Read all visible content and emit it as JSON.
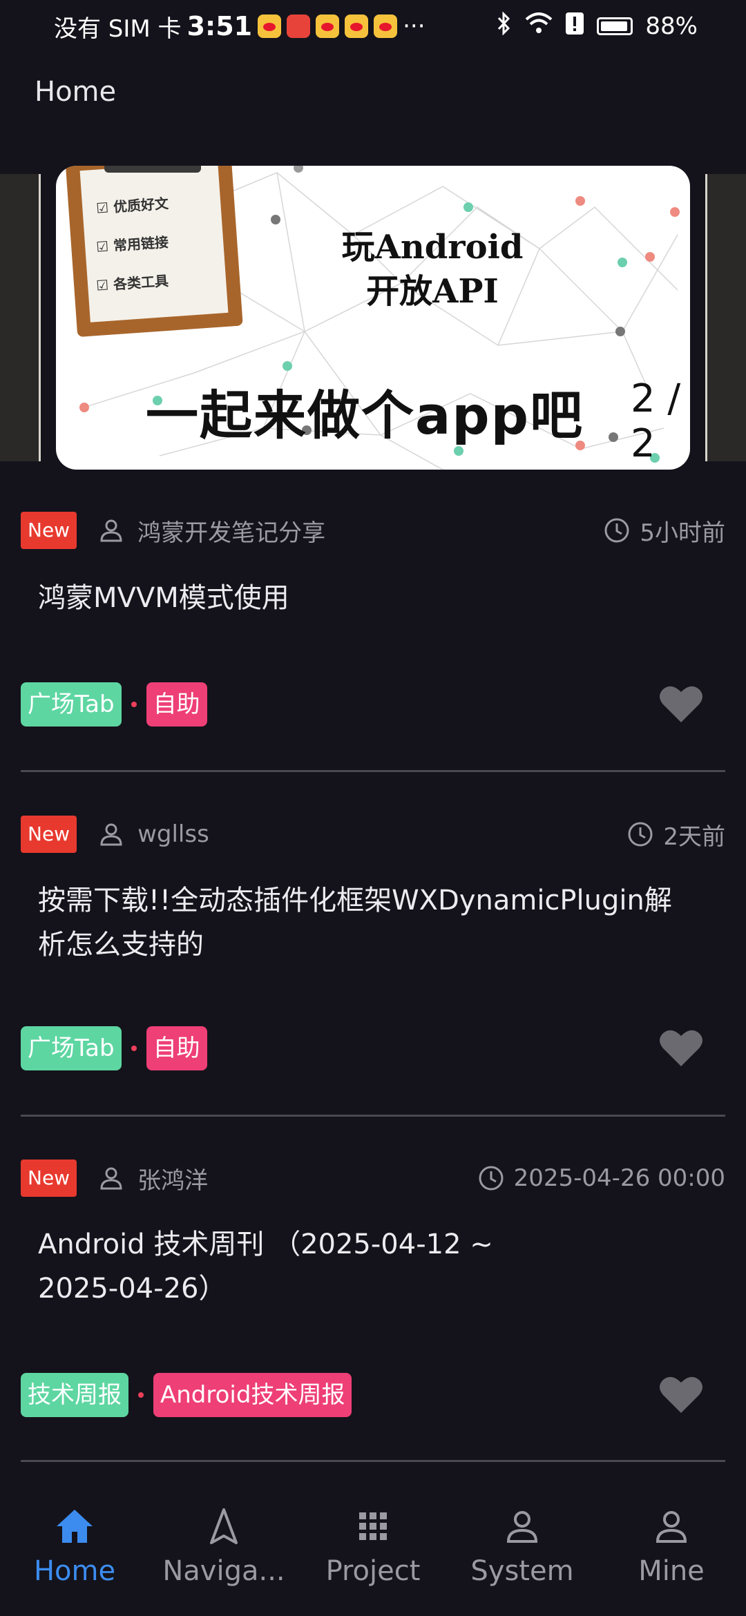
{
  "status_bar": {
    "carrier": "没有 SIM 卡",
    "time": "3:51",
    "more": "···",
    "battery": "88%"
  },
  "app_bar": {
    "title": "Home"
  },
  "banner": {
    "checklist": [
      "优质好文",
      "常用链接",
      "各类工具"
    ],
    "title_line1": "玩Android",
    "title_line2": "开放API",
    "slogan": "一起来做个app吧",
    "indicator": "2 / 2"
  },
  "articles": [
    {
      "badge": "New",
      "author": "鸿蒙开发笔记分享",
      "time": "5小时前",
      "title": "鸿蒙MVVM模式使用",
      "tags": [
        "广场Tab",
        "自助"
      ]
    },
    {
      "badge": "New",
      "author": "wgllss",
      "time": "2天前",
      "title": "按需下载!!全动态插件化框架WXDynamicPlugin解析怎么支持的",
      "tags": [
        "广场Tab",
        "自助"
      ]
    },
    {
      "badge": "New",
      "author": "张鸿洋",
      "time": "2025-04-26 00:00",
      "title": "Android 技术周刊 （2025-04-12 ~ 2025-04-26）",
      "tags": [
        "技术周报",
        "Android技术周报"
      ]
    }
  ],
  "bottom_nav": [
    {
      "label": "Home",
      "icon": "home-icon",
      "active": true
    },
    {
      "label": "Naviga...",
      "icon": "navigation-icon",
      "active": false
    },
    {
      "label": "Project",
      "icon": "grid-icon",
      "active": false
    },
    {
      "label": "System",
      "icon": "person-icon",
      "active": false
    },
    {
      "label": "Mine",
      "icon": "person-icon",
      "active": false
    }
  ],
  "colors": {
    "background": "#14131b",
    "accent": "#3c8cf0",
    "badge_red": "#e8392e",
    "tag_green": "#5ed6a2",
    "tag_pink": "#ee3f76"
  }
}
